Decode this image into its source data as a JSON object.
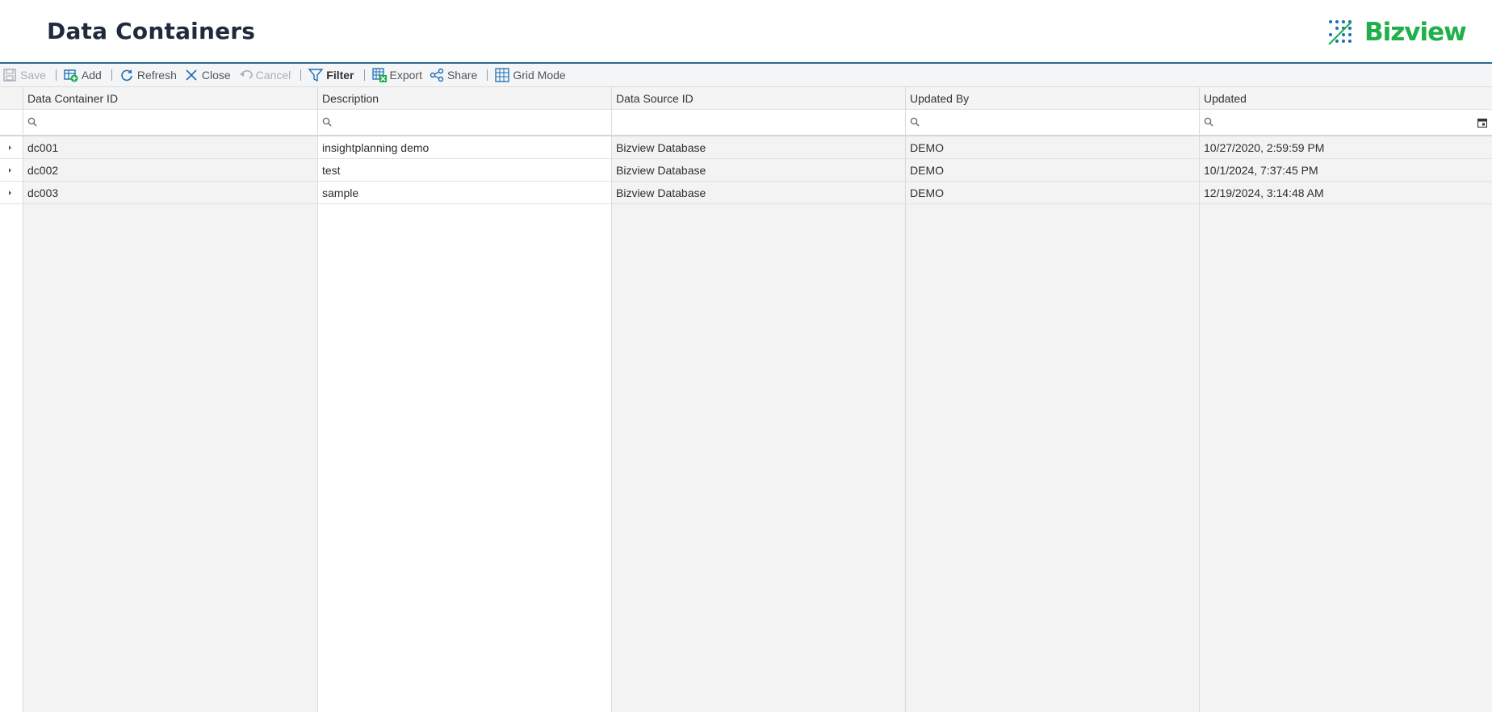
{
  "page": {
    "title": "Data Containers"
  },
  "logo": {
    "text": "Bizview",
    "color": "#1fb04a"
  },
  "toolbar": {
    "save": "Save",
    "add": "Add",
    "refresh": "Refresh",
    "close": "Close",
    "cancel": "Cancel",
    "filter": "Filter",
    "export": "Export",
    "share": "Share",
    "grid_mode": "Grid Mode"
  },
  "grid": {
    "columns": [
      "Data Container ID",
      "Description",
      "Data Source ID",
      "Updated By",
      "Updated"
    ],
    "rows": [
      [
        "dc001",
        "insightplanning demo",
        "Bizview Database",
        "DEMO",
        "10/27/2020, 2:59:59 PM"
      ],
      [
        "dc002",
        "test",
        "Bizview Database",
        "DEMO",
        "10/1/2024, 7:37:45 PM"
      ],
      [
        "dc003",
        "sample",
        "Bizview Database",
        "DEMO",
        "12/19/2024, 3:14:48 AM"
      ]
    ]
  },
  "colors": {
    "accent": "#2c6d8f",
    "title": "#1f2b3d",
    "grey_column": "#f4f4f4"
  }
}
